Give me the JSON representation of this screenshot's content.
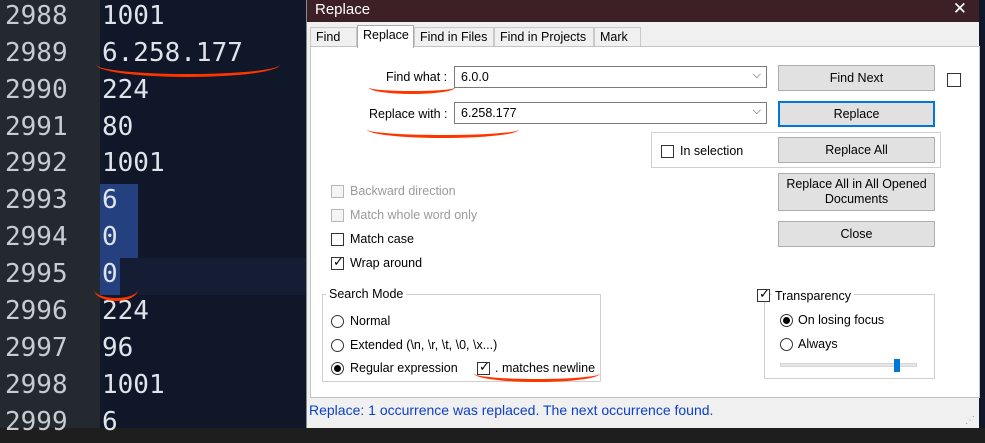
{
  "editor": {
    "lines": [
      {
        "num": "2988",
        "text": "1001"
      },
      {
        "num": "2989",
        "text": "6.258.177"
      },
      {
        "num": "2990",
        "text": "224"
      },
      {
        "num": "2991",
        "text": "80"
      },
      {
        "num": "2992",
        "text": "1001"
      },
      {
        "num": "2993",
        "text": "6"
      },
      {
        "num": "2994",
        "text": "0"
      },
      {
        "num": "2995",
        "text": "0"
      },
      {
        "num": "2996",
        "text": "224"
      },
      {
        "num": "2997",
        "text": "96"
      },
      {
        "num": "2998",
        "text": "1001"
      },
      {
        "num": "2999",
        "text": "6"
      }
    ]
  },
  "dialog": {
    "title": "Replace",
    "close_glyph": "✕",
    "tabs": [
      "Find",
      "Replace",
      "Find in Files",
      "Find in Projects",
      "Mark"
    ],
    "find_what_label": "Find what :",
    "find_what_value": "6.0.0",
    "replace_with_label": "Replace with :",
    "replace_with_value": "6.258.177",
    "buttons": {
      "find_next": "Find Next",
      "replace": "Replace",
      "replace_all": "Replace All",
      "replace_all_opened_line1": "Replace All in All Opened",
      "replace_all_opened_line2": "Documents",
      "close": "Close"
    },
    "in_selection": "In selection",
    "options": {
      "backward": "Backward direction",
      "whole_word": "Match whole word only",
      "match_case": "Match case",
      "wrap_around": "Wrap around"
    },
    "search_mode": {
      "title": "Search Mode",
      "normal": "Normal",
      "extended": "Extended (\\n, \\r, \\t, \\0, \\x...)",
      "regex": "Regular expression",
      "matches_newline": ". matches newline"
    },
    "transparency": {
      "title": "Transparency",
      "on_losing_focus": "On losing focus",
      "always": "Always",
      "level": 0.78
    },
    "status": "Replace: 1 occurrence was replaced. The next occurrence found.",
    "colors": {
      "status_text": "#0b3fc8",
      "annotation": "#ff3500",
      "selection": "#24407e"
    }
  }
}
